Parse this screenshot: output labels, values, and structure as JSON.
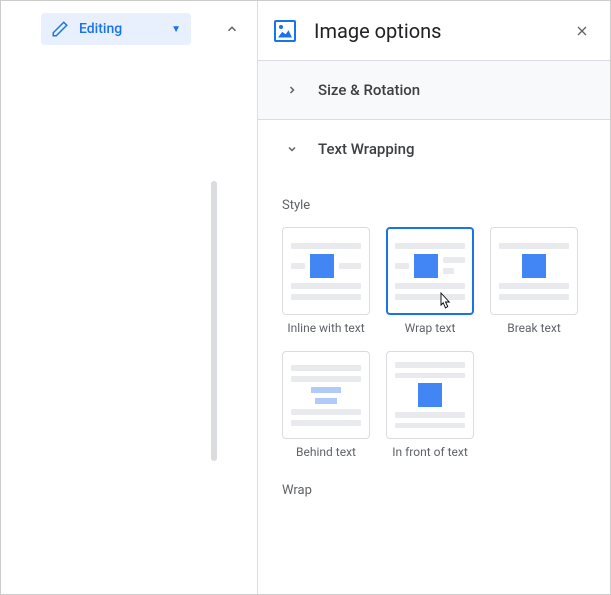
{
  "toolbar": {
    "editing_label": "Editing"
  },
  "panel": {
    "title": "Image options",
    "sections": {
      "size_rotation": {
        "title": "Size & Rotation"
      },
      "text_wrapping": {
        "title": "Text Wrapping",
        "style_heading": "Style",
        "wrap_heading": "Wrap",
        "styles": {
          "inline": "Inline with text",
          "wrap": "Wrap text",
          "break": "Break text",
          "behind": "Behind text",
          "front": "In front of text"
        }
      }
    }
  }
}
